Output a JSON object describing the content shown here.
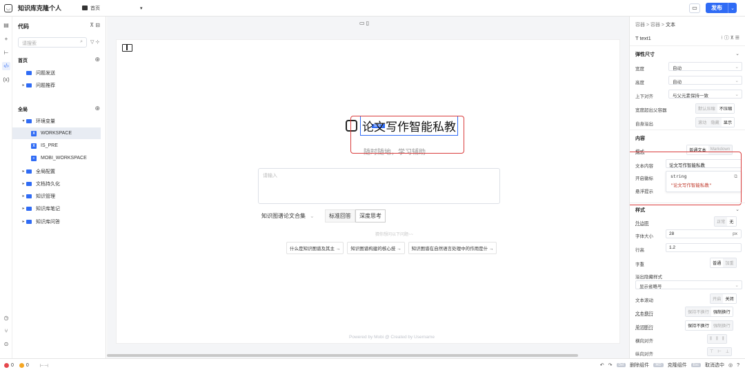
{
  "app": {
    "title": "知识库克隆个人",
    "home_label": "首页",
    "page_dropdown": "▾",
    "publish_label": "发布"
  },
  "rail": {
    "icons": [
      "page-icon",
      "add-icon",
      "tree-icon",
      "code-icon",
      "variable-icon",
      "history-icon",
      "branch-icon",
      "settings-icon"
    ]
  },
  "left": {
    "title": "代码",
    "search_placeholder": "请搜索",
    "section_home": "首页",
    "home_items": [
      "问题发送",
      "问题推荐"
    ],
    "section_global": "全局",
    "env_folder": "环境变量",
    "env_vars": [
      "WORKSPACE",
      "IS_PRE",
      "MOBI_WORKSPACE"
    ],
    "global_items": [
      "全局配置",
      "文档持久化",
      "知识管理",
      "知识库笔记",
      "知识库问答"
    ]
  },
  "canvas": {
    "tag": "text1",
    "hero_title": "论文写作智能私教",
    "hero_subtitle": "随时随地，学习辅助",
    "input_placeholder": "请输入",
    "kb_select": "知识图谱论文合集",
    "mode_standard": "标准回答",
    "mode_deep": "深度思考",
    "guess_label": "猜你想问以下问题~~",
    "suggestions": [
      "什么是知识图谱及其主 →",
      "知识图谱构建的核心技 →",
      "知识图谱在自然语言处理中的作用是什 →"
    ],
    "powered": "Powered by Mobi @ Created by Username"
  },
  "right": {
    "crumb1": "容器",
    "crumb2": "容器",
    "crumb3": "文本",
    "comp_name": "T  text1",
    "group_flex": "弹性尺寸",
    "width_label": "宽度",
    "width_value": "自动",
    "height_label": "高度",
    "height_value": "自动",
    "valign_label": "上下对齐",
    "valign_value": "与父元素保持一致",
    "overflow_parent_label": "宽度超出父容器",
    "overflow_parent_opt1": "默认压缩",
    "overflow_parent_opt2": "不压缩",
    "self_overflow_label": "自身溢出",
    "self_overflow_opt1": "滚动",
    "self_overflow_opt2": "隐藏",
    "self_overflow_opt3": "显示",
    "group_content": "内容",
    "mode_label": "模式",
    "mode_opt1": "普通文本",
    "mode_opt2": "Markdown",
    "content_label": "文本内容",
    "content_value": "论文写作智能私教",
    "code_type": "string",
    "code_value": "\"论文写作智能私教\"",
    "corner_label": "开启徽标",
    "tooltip_label": "悬浮提示",
    "group_style": "样式",
    "margin_label": "外边距",
    "margin_opt1": "正常",
    "margin_opt2": "无",
    "font_size_label": "字体大小",
    "font_size_value": "28",
    "font_size_unit": "px",
    "line_height_label": "行高",
    "line_height_value": "1.2",
    "weight_label": "字重",
    "weight_opt1": "普通",
    "weight_opt2": "加重",
    "ellipsis_label": "溢出隐藏样式",
    "ellipsis_value": "显示省略号",
    "scroll_label": "文本滚动",
    "scroll_opt1": "开启",
    "scroll_opt2": "关闭",
    "wrap_label": "文本换行",
    "wrap_opt1": "保持不换行",
    "wrap_opt2": "强制换行",
    "word_break_label": "单词断行",
    "word_break_opt1": "保持不换行",
    "word_break_opt2": "强制换行",
    "halign_label": "横向对齐",
    "valign2_label": "纵向对齐"
  },
  "status": {
    "errors": "0",
    "warnings": "0",
    "separator": "⊢⊣",
    "delete_key": "Del",
    "delete_label": "删除组件",
    "clone_key": "⌘D",
    "clone_label": "克隆组件",
    "esc_key": "Esc",
    "esc_label": "取消选中"
  }
}
